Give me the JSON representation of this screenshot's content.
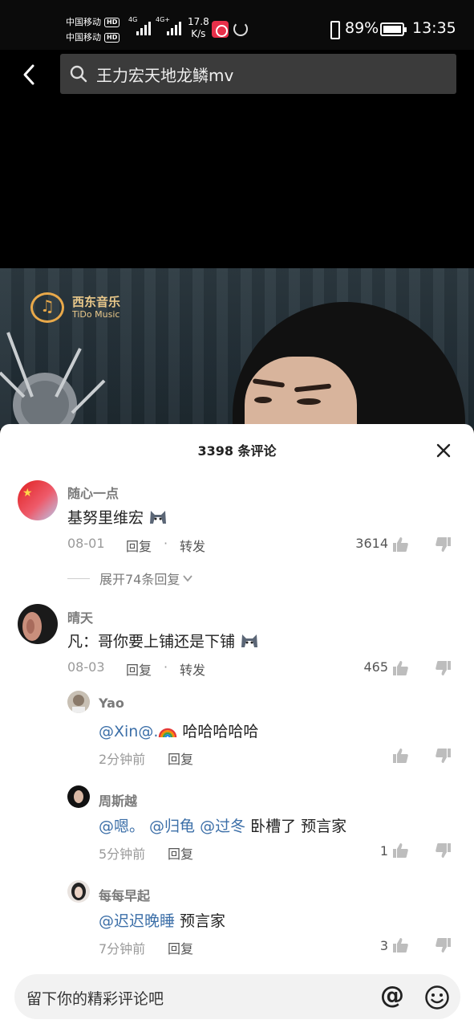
{
  "status_bar": {
    "carrier_1": "中国移动",
    "carrier_2": "中国移动",
    "hd_badge": "HD",
    "net_1": "4G",
    "net_2": "4G+",
    "speed_value": "17.8",
    "speed_unit": "K/s",
    "battery": "89%",
    "time": "13:35"
  },
  "search": {
    "query": "王力宏天地龙鳞mv"
  },
  "video": {
    "logo_cn": "西东音乐",
    "logo_en": "TiDo Music"
  },
  "comments_panel": {
    "title": "3398 条评论",
    "reply_label": "回复",
    "forward_label": "转发",
    "comments": [
      {
        "user": "随心一点",
        "text": "基努里维宏",
        "date": "08-01",
        "likes": "3614",
        "expand": "展开74条回复"
      },
      {
        "user": "晴天",
        "text": "凡：哥你要上铺还是下铺",
        "date": "08-03",
        "likes": "465"
      }
    ],
    "replies": [
      {
        "user": "Yao",
        "mention": "@Xin@.",
        "text": " 哈哈哈哈哈",
        "time": "2分钟前",
        "likes": ""
      },
      {
        "user": "周斯越",
        "mention": "@嗯。 @归龟 @过冬",
        "text": " 卧槽了 预言家",
        "time": "5分钟前",
        "likes": "1"
      },
      {
        "user": "每每早起",
        "mention": "@迟迟晚睡",
        "text": " 预言家",
        "time": "7分钟前",
        "likes": "3"
      }
    ]
  },
  "input": {
    "placeholder": "留下你的精彩评论吧",
    "at_symbol": "@"
  },
  "colors": {
    "mention": "#3c6fa8",
    "sheet_bg": "#ffffff",
    "search_bg": "#3b3b3b"
  }
}
